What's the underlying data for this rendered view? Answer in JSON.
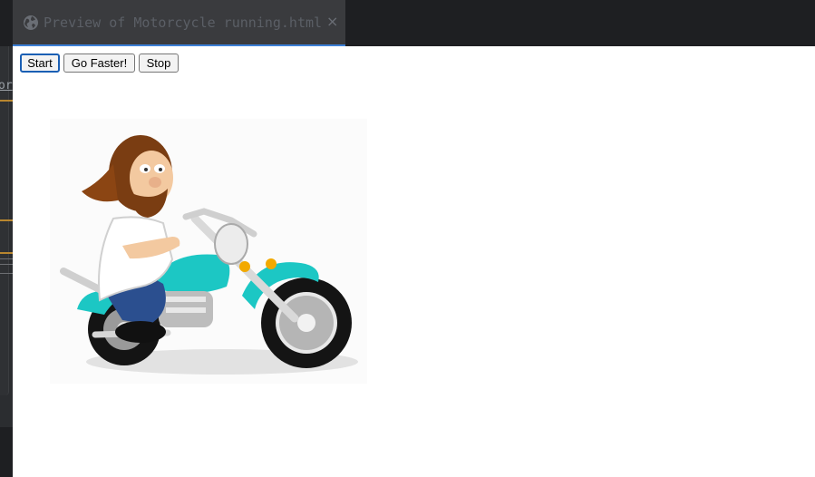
{
  "tab": {
    "title": "Preview of Motorcycle running.html",
    "close": "×",
    "icon": "globe-icon"
  },
  "controls": {
    "start_label": "Start",
    "faster_label": "Go Faster!",
    "stop_label": "Stop"
  },
  "gutter": {
    "fragment": "or"
  },
  "image": {
    "subject": "cartoon-biker-on-motorcycle"
  },
  "colors": {
    "tab_accent": "#3c7fd6",
    "bike_teal": "#1cc7c4",
    "button_focus": "#1a5fb4"
  }
}
